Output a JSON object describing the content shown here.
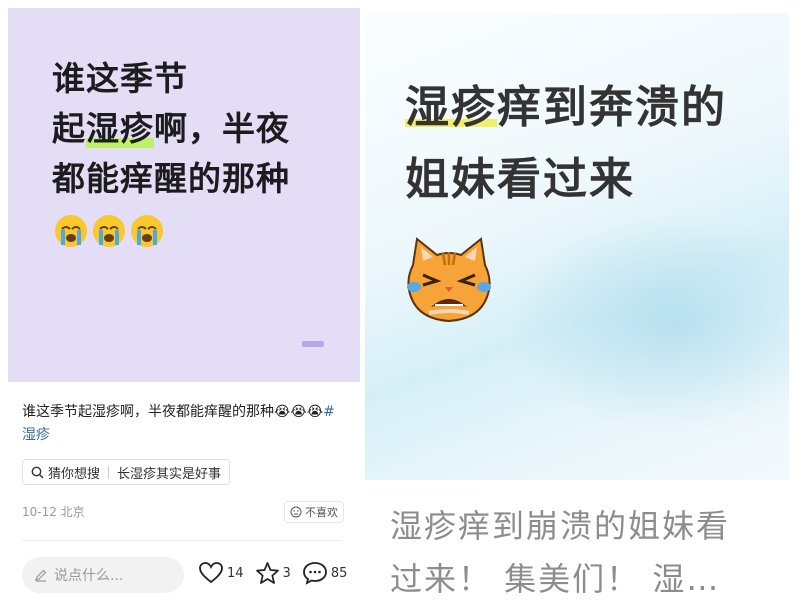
{
  "left": {
    "card": {
      "line1": "谁这季节",
      "line2_pre": "起",
      "line2_mark": "湿疹",
      "line2_post": "啊，半夜",
      "line3": "都能痒醒的那种",
      "emoji_name": "loudly-crying-face-emoji"
    },
    "caption": "谁这季节起湿疹啊，半夜都能痒醒的那种😭😭😭",
    "hashtag": "#湿疹",
    "search": {
      "label": "猜你想搜",
      "query": "长湿疹其实是好事"
    },
    "date": "10-12 北京",
    "dislike_label": "不喜欢",
    "comment_placeholder": "说点什么...",
    "likes": "14",
    "stars": "3",
    "comments": "85"
  },
  "right": {
    "title1_mark": "湿疹",
    "title1_rest": "痒到奔溃的",
    "title2": "姐妹看过来",
    "emoji_name": "crying-cat-emoji",
    "bottom_line1": "湿疹痒到崩溃的姐妹看",
    "bottom_line2": "过来！ 集美们！ 湿…"
  },
  "colors": {
    "card_bg": "#e3def5",
    "highlight_green": "#bff065",
    "highlight_yellow": "#f3ee6a",
    "hashtag": "#3a6ea5"
  }
}
